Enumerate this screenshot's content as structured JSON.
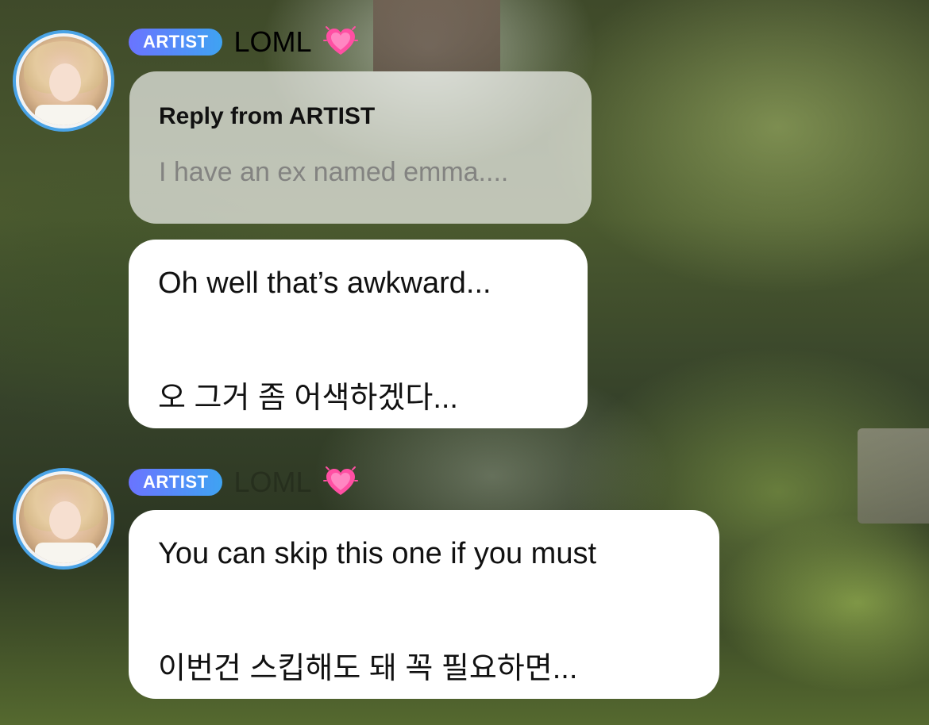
{
  "background": {
    "colors": {
      "foliage_dark": "#2c3622",
      "foliage_mid": "#4b5a2f",
      "foliage_light": "#a9c05a"
    }
  },
  "badge": {
    "label": "ARTIST",
    "gradient_start": "#6a74ff",
    "gradient_end": "#3fa3f2"
  },
  "messages": [
    {
      "sender": "LOML",
      "heart_icon": "growing-heart-icon",
      "reply": {
        "title": "Reply from ARTIST",
        "quoted_text": "I have an ex named emma...."
      },
      "lines": {
        "english": "Oh well that’s awkward...",
        "korean": "오 그거 좀 어색하겠다..."
      }
    },
    {
      "sender": "LOML",
      "heart_icon": "growing-heart-icon",
      "lines": {
        "english": "You can skip this one if you must",
        "korean": "이번건 스킵해도 돼 꼭 필요하면..."
      }
    }
  ]
}
